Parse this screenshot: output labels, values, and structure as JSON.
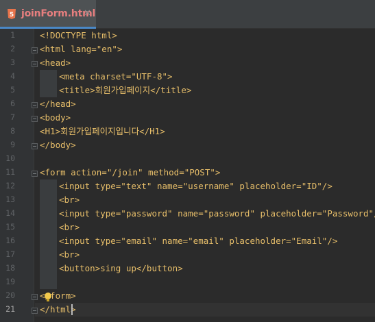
{
  "tab": {
    "title": "joinForm.html",
    "icon": "html5-icon",
    "close": "✕"
  },
  "current_line": 21,
  "line_numbers": [
    "1",
    "2",
    "3",
    "4",
    "5",
    "6",
    "7",
    "8",
    "9",
    "10",
    "11",
    "12",
    "13",
    "14",
    "15",
    "16",
    "17",
    "18",
    "19",
    "20",
    "21"
  ],
  "code": [
    "<!DOCTYPE html>",
    "<html lang=\"en\">",
    "<head>",
    "<meta charset=\"UTF-8\">",
    "<title>회원가입페이지</title>",
    "</head>",
    "<body>",
    "<H1>회원가입페이지입니다</H1>",
    "</body>",
    "",
    "<form action=\"/join\" method=\"POST\">",
    "<input type=\"text\" name=\"username\" placeholder=\"ID\"/>",
    "<br>",
    "<input type=\"password\" name=\"password\" placeholder=\"Password\"/>",
    "<br>",
    "<input type=\"email\" name=\"email\" placeholder=\"Email\"/>",
    "<br>",
    "<button>sing up</button>",
    "",
    "</form>",
    "</html>"
  ],
  "colors": {
    "tag": "#e8bf6a",
    "attribute": "#bababa",
    "value": "#6a8759",
    "text": "#a9b7c6",
    "tab_title": "#e87f7f",
    "background": "#2b2b2b"
  }
}
